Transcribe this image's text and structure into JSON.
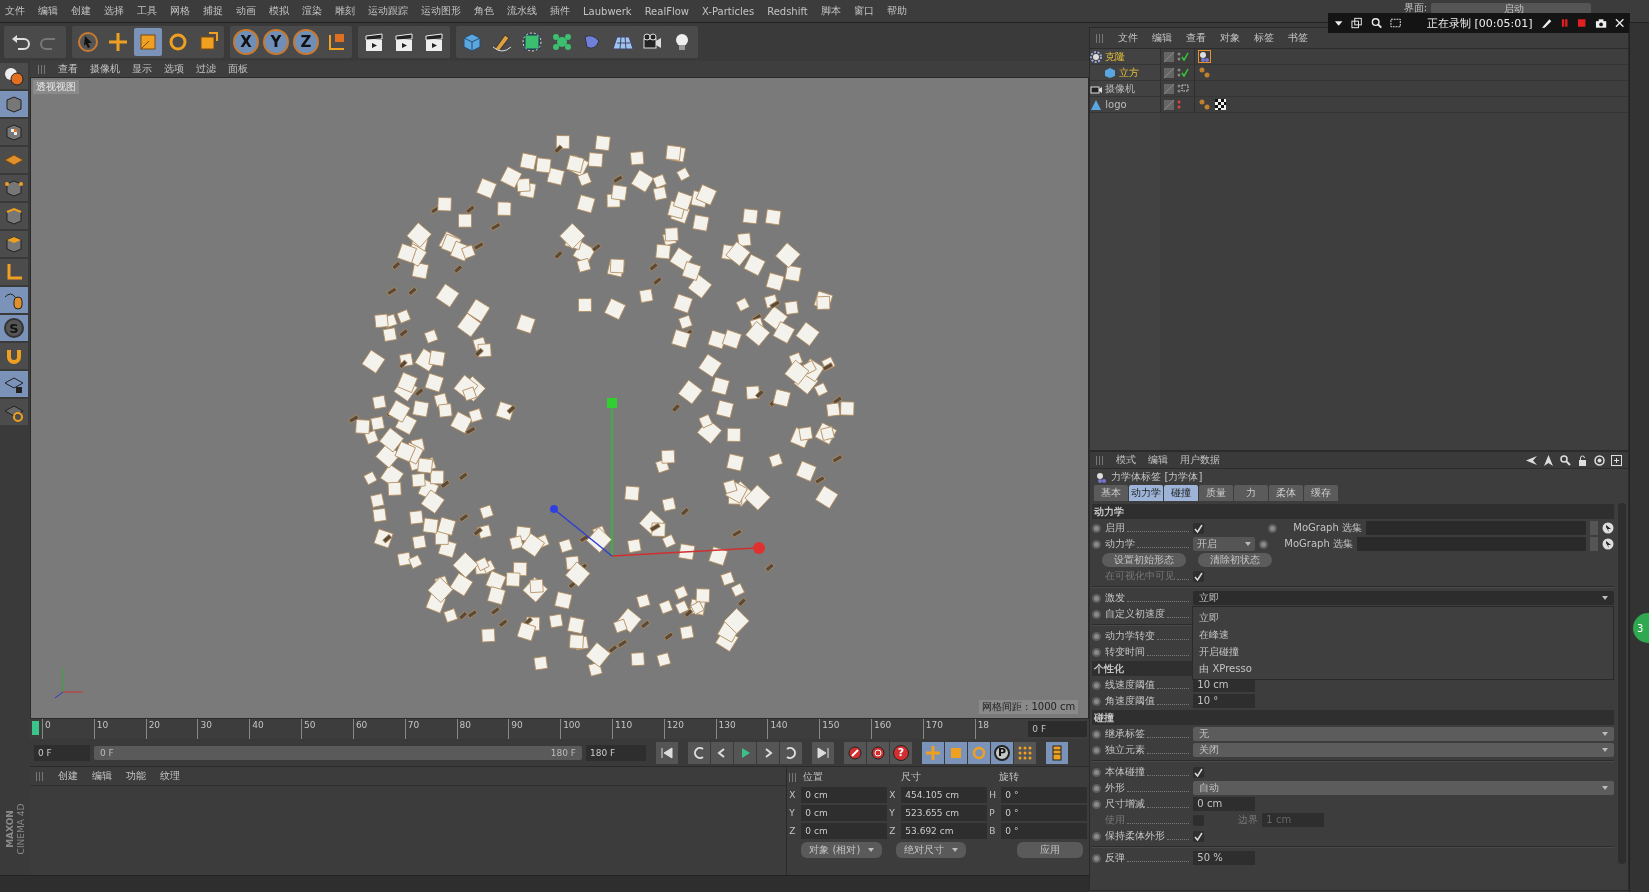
{
  "menu_bar": [
    "文件",
    "编辑",
    "创建",
    "选择",
    "工具",
    "网格",
    "捕捉",
    "动画",
    "模拟",
    "渲染",
    "雕刻",
    "运动跟踪",
    "运动图形",
    "角色",
    "流水线",
    "插件",
    "Laubwerk",
    "RealFlow",
    "X-Particles",
    "Redshift",
    "脚本",
    "窗口",
    "帮助"
  ],
  "layout_selector": {
    "label": "界面:",
    "value": "启动"
  },
  "recorder": {
    "status": "正在录制 [00:05:01]"
  },
  "toolbar": {
    "axis_buttons": [
      "X",
      "Y",
      "Z"
    ]
  },
  "tool_column": {
    "snap_letter": "S"
  },
  "viewport": {
    "menu": [
      "查看",
      "摄像机",
      "显示",
      "选项",
      "过滤",
      "面板"
    ],
    "view_name": "透视视图",
    "grid_info": "网格间距 : 1000 cm"
  },
  "timeline": {
    "range_slider": {
      "level": 1
    },
    "ticks": [
      "0",
      "10",
      "20",
      "30",
      "40",
      "50",
      "60",
      "70",
      "80",
      "90",
      "100",
      "110",
      "120",
      "130",
      "140",
      "150",
      "160",
      "170",
      "18"
    ],
    "current_frame": "0 F",
    "start_field": "0 F",
    "slider_start": "0 F",
    "slider_end": "180 F",
    "end_field": "180 F",
    "help_key_mark": "?",
    "point_key_mark": "P"
  },
  "material_manager": {
    "menu": [
      "创建",
      "编辑",
      "功能",
      "纹理"
    ]
  },
  "brand": {
    "line_1": "MAXON",
    "line_2": "CINEMA 4D"
  },
  "coordinates": {
    "headers": [
      "位置",
      "尺寸",
      "旋转"
    ],
    "rows": [
      {
        "cells": [
          {
            "axis": "X",
            "value": "0 cm"
          },
          {
            "axis": "X",
            "value": "454.105 cm"
          },
          {
            "axis": "H",
            "value": "0 °"
          }
        ]
      },
      {
        "cells": [
          {
            "axis": "Y",
            "value": "0 cm"
          },
          {
            "axis": "Y",
            "value": "523.655 cm"
          },
          {
            "axis": "P",
            "value": "0 °"
          }
        ]
      },
      {
        "cells": [
          {
            "axis": "Z",
            "value": "0 cm"
          },
          {
            "axis": "Z",
            "value": "53.692 cm"
          },
          {
            "axis": "B",
            "value": "0 °"
          }
        ]
      }
    ],
    "mode_dropdown": "对象 (相对)",
    "size_dropdown": "绝对尺寸",
    "apply_button": "应用"
  },
  "object_manager": {
    "menu": [
      "文件",
      "编辑",
      "查看",
      "对象",
      "标签",
      "书签"
    ],
    "objects": [
      {
        "name": "克隆",
        "kind": "cloner",
        "selected": true,
        "enabled": true,
        "tags": [
          {
            "kind": "dynamics",
            "selected": true
          }
        ],
        "children": [
          {
            "name": "立方",
            "kind": "cube",
            "selected": true,
            "enabled": true,
            "tags": [
              {
                "kind": "phong",
                "selected": false
              }
            ]
          }
        ]
      },
      {
        "name": "摄像机",
        "kind": "camera",
        "selected": false,
        "enabled": true
      },
      {
        "name": "logo",
        "kind": "null",
        "selected": false,
        "enabled": false,
        "tags": [
          {
            "kind": "phong",
            "selected": false
          },
          {
            "kind": "material",
            "selected": false
          }
        ]
      }
    ]
  },
  "attributes": {
    "menu": [
      "模式",
      "编辑",
      "用户数据"
    ],
    "title": "力学体标签 [力学体]",
    "tabs": [
      {
        "label": "基本",
        "selected": false
      },
      {
        "label": "动力学",
        "selected": true
      },
      {
        "label": "碰撞",
        "selected": true
      },
      {
        "label": "质量",
        "selected": false
      },
      {
        "label": "力",
        "selected": false
      },
      {
        "label": "柔体",
        "selected": false
      },
      {
        "label": "缓存",
        "selected": false
      }
    ],
    "rows": [
      {
        "kind": "section",
        "label": "动力学"
      },
      {
        "kind": "check_mograph",
        "label": "启用",
        "checked": true,
        "mograph_label": "MoGraph 选集"
      },
      {
        "kind": "dropdown_mograph",
        "label": "动力学",
        "value": "开启",
        "mograph_label": "MoGraph 选集"
      },
      {
        "kind": "buttons",
        "buttons": [
          "设置初始形态",
          "清除初状态"
        ]
      },
      {
        "kind": "check",
        "label": "在可视化中可见",
        "checked": true,
        "disabled": true
      },
      {
        "kind": "divider"
      },
      {
        "kind": "dropdown",
        "label": "激发",
        "value": "立即",
        "options": [
          "立即",
          "在峰速",
          "开启碰撞",
          "由 XPresso"
        ]
      },
      {
        "kind": "plain",
        "label": "自定义初速度"
      },
      {
        "kind": "divider"
      },
      {
        "kind": "plain",
        "label": "动力学转变"
      },
      {
        "kind": "plain",
        "label": "转变时间"
      },
      {
        "kind": "section",
        "label": "个性化"
      },
      {
        "kind": "number",
        "label": "线速度阈值",
        "value": "10 cm"
      },
      {
        "kind": "number",
        "label": "角速度阈值",
        "value": "10 °"
      },
      {
        "kind": "section",
        "label": "碰撞"
      },
      {
        "kind": "dropdown",
        "label": "继承标签",
        "value": "无"
      },
      {
        "kind": "dropdown",
        "label": "独立元素",
        "value": "关闭"
      },
      {
        "kind": "divider"
      },
      {
        "kind": "check",
        "label": "本体碰撞",
        "checked": true,
        "disabled": false
      },
      {
        "kind": "dropdown",
        "label": "外形",
        "value": "自动"
      },
      {
        "kind": "number",
        "label": "尺寸增减",
        "value": "0 cm"
      },
      {
        "kind": "check_number",
        "label": "使用",
        "checked": false,
        "disabled": true,
        "sub_label": "边界",
        "value": "1 cm"
      },
      {
        "kind": "check",
        "label": "保持柔体外形",
        "checked": true,
        "disabled": false
      },
      {
        "kind": "divider"
      },
      {
        "kind": "number",
        "label": "反弹",
        "value": "50 %"
      }
    ]
  },
  "side_widget": {
    "text": "3"
  }
}
